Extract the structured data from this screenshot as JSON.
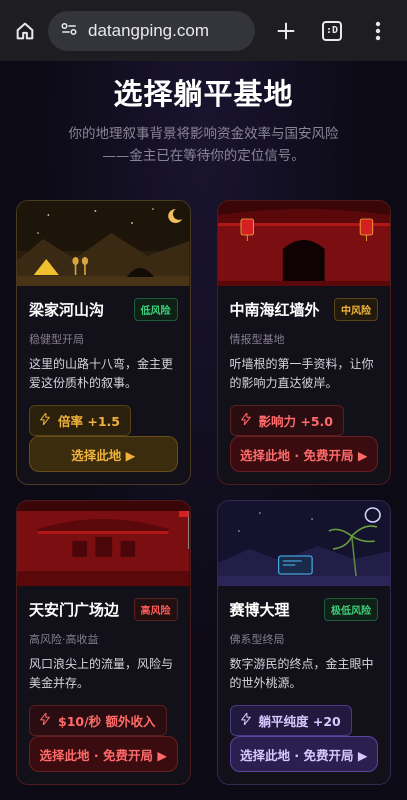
{
  "browser": {
    "url": "datangping.com",
    "tab_count": ":D"
  },
  "header": {
    "title": "选择躺平基地",
    "subtitle_line1": "你的地理叙事背景将影响资金效率与国安风险",
    "subtitle_line2": "——金主已在等待你的定位信号。"
  },
  "cards": [
    {
      "name": "梁家河山沟",
      "risk": "低风险",
      "tagline": "稳健型开局",
      "desc": "这里的山路十八弯，金主更爱这份质朴的叙事。",
      "stat": "倍率 +1.5",
      "cta": "选择此地 ▶"
    },
    {
      "name": "中南海红墙外",
      "risk": "中风险",
      "tagline": "情报型基地",
      "desc": "听墙根的第一手资料，让你的影响力直达彼岸。",
      "stat": "影响力 +5.0",
      "cta": "选择此地 · 免费开局 ▶"
    },
    {
      "name": "天安门广场边",
      "risk": "高风险",
      "tagline": "高风险·高收益",
      "desc": "风口浪尖上的流量，风险与美金并存。",
      "stat": "$10/秒 额外收入",
      "cta": "选择此地 · 免费开局 ▶"
    },
    {
      "name": "赛博大理",
      "risk": "极低风险",
      "tagline": "佛系型终局",
      "desc": "数字游民的终点，金主眼中的世外桃源。",
      "stat": "躺平纯度 +20",
      "cta": "选择此地 · 免费开局 ▶"
    }
  ],
  "colors": {
    "gold": "#f0b23c",
    "red": "#ff6a6a",
    "purple": "#d9c7ff",
    "green": "#3ecf7a"
  }
}
